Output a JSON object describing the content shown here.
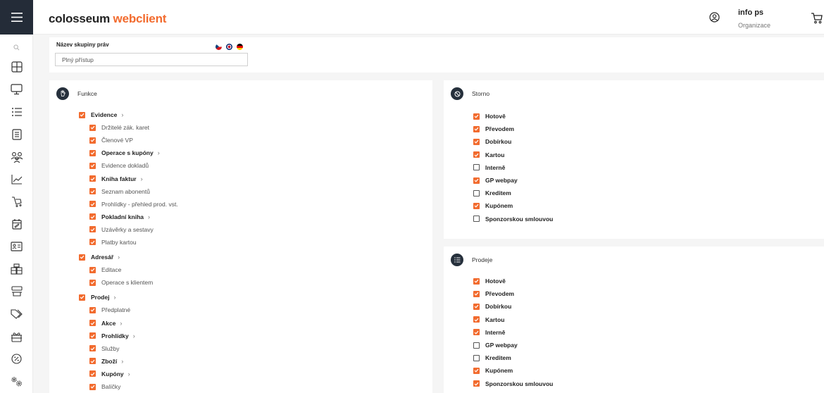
{
  "app": {
    "logo_part1": "colosseum",
    "logo_part2": "webclient"
  },
  "user": {
    "name": "info ps",
    "org": "Organizace"
  },
  "group_name": {
    "label": "Název skupiny práv",
    "value": "Plný přístup"
  },
  "colors": {
    "accent": "#f26b2e",
    "dark": "#26303c"
  },
  "funkce": {
    "title": "Funkce",
    "items": [
      {
        "label": "Evidence",
        "level": 0,
        "group": true,
        "expandable": true
      },
      {
        "label": "Držitelé zák. karet",
        "level": 1,
        "group": false,
        "expandable": false
      },
      {
        "label": "Členové VP",
        "level": 1,
        "group": false,
        "expandable": false
      },
      {
        "label": "Operace s kupóny",
        "level": 1,
        "group": true,
        "expandable": true
      },
      {
        "label": "Evidence dokladů",
        "level": 1,
        "group": false,
        "expandable": false
      },
      {
        "label": "Kniha faktur",
        "level": 1,
        "group": true,
        "expandable": true
      },
      {
        "label": "Seznam abonentů",
        "level": 1,
        "group": false,
        "expandable": false
      },
      {
        "label": "Prohlídky - přehled prod. vst.",
        "level": 1,
        "group": false,
        "expandable": false
      },
      {
        "label": "Pokladní kniha",
        "level": 1,
        "group": true,
        "expandable": true
      },
      {
        "label": "Uzávěrky a sestavy",
        "level": 1,
        "group": false,
        "expandable": false
      },
      {
        "label": "Platby kartou",
        "level": 1,
        "group": false,
        "expandable": false
      },
      {
        "label": "Adresář",
        "level": 0,
        "group": true,
        "expandable": true
      },
      {
        "label": "Editace",
        "level": 1,
        "group": false,
        "expandable": false
      },
      {
        "label": "Operace s klientem",
        "level": 1,
        "group": false,
        "expandable": false
      },
      {
        "label": "Prodej",
        "level": 0,
        "group": true,
        "expandable": true
      },
      {
        "label": "Předplatné",
        "level": 1,
        "group": false,
        "expandable": false
      },
      {
        "label": "Akce",
        "level": 1,
        "group": true,
        "expandable": true
      },
      {
        "label": "Prohlídky",
        "level": 1,
        "group": true,
        "expandable": true
      },
      {
        "label": "Služby",
        "level": 1,
        "group": false,
        "expandable": false
      },
      {
        "label": "Zboží",
        "level": 1,
        "group": true,
        "expandable": true
      },
      {
        "label": "Kupóny",
        "level": 1,
        "group": true,
        "expandable": true
      },
      {
        "label": "Balíčky",
        "level": 1,
        "group": false,
        "expandable": false
      }
    ]
  },
  "storno": {
    "title": "Storno",
    "items": [
      {
        "label": "Hotově",
        "checked": true
      },
      {
        "label": "Převodem",
        "checked": true
      },
      {
        "label": "Dobírkou",
        "checked": true
      },
      {
        "label": "Kartou",
        "checked": true
      },
      {
        "label": "Interně",
        "checked": false
      },
      {
        "label": "GP webpay",
        "checked": true
      },
      {
        "label": "Kreditem",
        "checked": false
      },
      {
        "label": "Kupónem",
        "checked": true
      },
      {
        "label": "Sponzorskou smlouvou",
        "checked": false
      }
    ]
  },
  "prodeje": {
    "title": "Prodeje",
    "items": [
      {
        "label": "Hotově",
        "checked": true
      },
      {
        "label": "Převodem",
        "checked": true
      },
      {
        "label": "Dobírkou",
        "checked": true
      },
      {
        "label": "Kartou",
        "checked": true
      },
      {
        "label": "Interně",
        "checked": true
      },
      {
        "label": "GP webpay",
        "checked": false
      },
      {
        "label": "Kreditem",
        "checked": false
      },
      {
        "label": "Kupónem",
        "checked": true
      },
      {
        "label": "Sponzorskou smlouvou",
        "checked": true
      }
    ]
  },
  "sidebar": {
    "icons": [
      "search-icon",
      "grid-icon",
      "monitor-icon",
      "list-icon",
      "document-list-icon",
      "users-icon",
      "chart-icon",
      "cart-outline-icon",
      "calendar-icon",
      "id-card-icon",
      "cash-register-icon",
      "stack-icon",
      "tags-icon",
      "gift-icon",
      "discount-icon",
      "settings-icon"
    ]
  }
}
